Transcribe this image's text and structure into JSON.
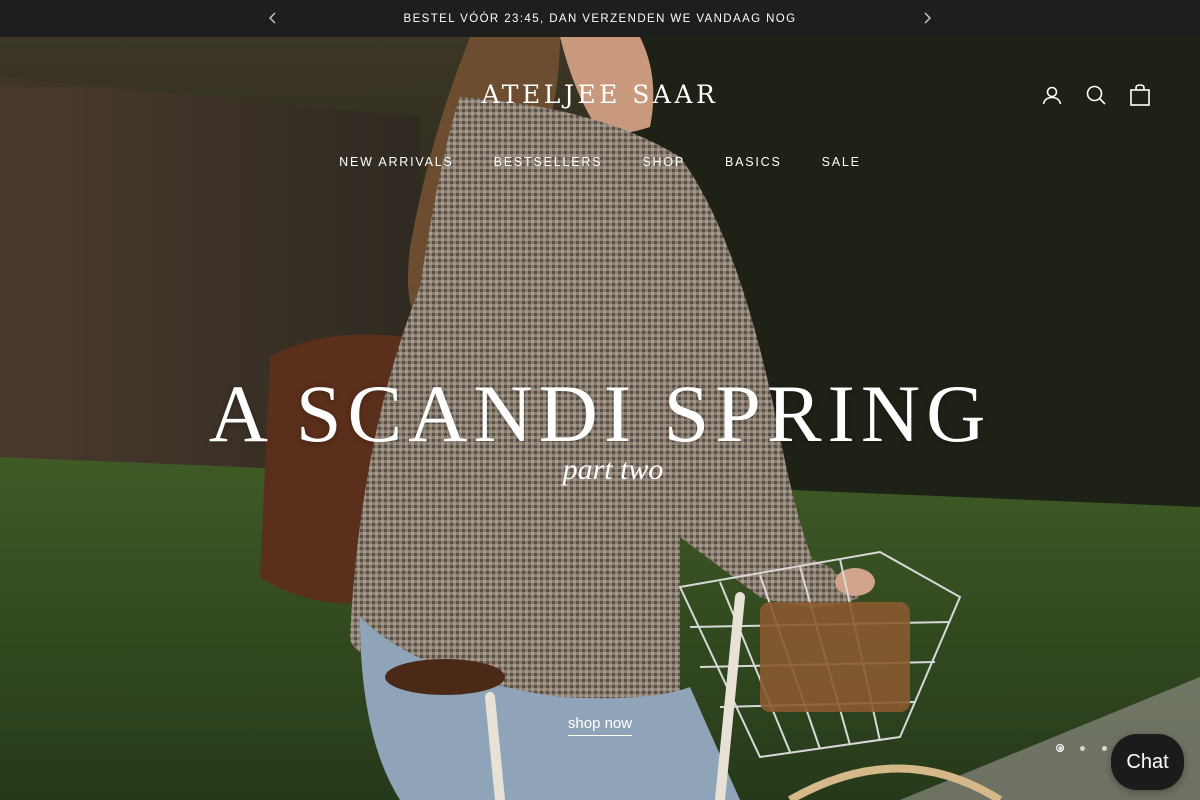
{
  "announcement": {
    "text": "BESTEL VÓÓR 23:45, DAN VERZENDEN WE VANDAAG NOG",
    "prev_icon": "chevron-left-icon",
    "next_icon": "chevron-right-icon"
  },
  "header": {
    "logo": "ATELJEE SAAR",
    "icons": [
      "account-icon",
      "search-icon",
      "bag-icon"
    ]
  },
  "nav": {
    "items": [
      {
        "label": "NEW ARRIVALS"
      },
      {
        "label": "BESTSELLERS"
      },
      {
        "label": "SHOP"
      },
      {
        "label": "BASICS"
      },
      {
        "label": "SALE"
      }
    ]
  },
  "hero": {
    "headline": "A SCANDI SPRING",
    "subheadline": "part two",
    "cta": "shop now",
    "slides_count": 3,
    "active_slide": 1
  },
  "chat": {
    "label": "Chat"
  },
  "colors": {
    "announcement_bg": "#1e1e1e",
    "text": "#ffffff",
    "chat_bg": "#1b1b1b"
  }
}
